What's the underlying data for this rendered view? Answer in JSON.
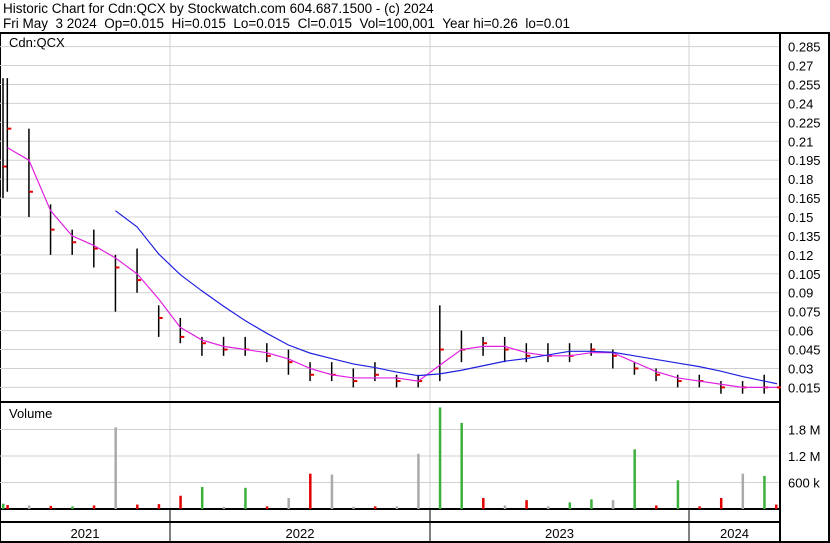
{
  "header": {
    "title": "Historic Chart for Cdn:QCX by Stockwatch.com 604.687.1500 - (c) 2024",
    "quote": "Fri May  3 2024  Op=0.015  Hi=0.015  Lo=0.015  Cl=0.015  Vol=100,001  Year hi=0.26  lo=0.01"
  },
  "chart_data": [
    {
      "type": "line",
      "title": "Cdn:QCX",
      "ylim": [
        0.005,
        0.295
      ],
      "yticks": [
        "0.285",
        "0.27",
        "0.255",
        "0.24",
        "0.225",
        "0.21",
        "0.195",
        "0.18",
        "0.165",
        "0.15",
        "0.135",
        "0.12",
        "0.105",
        "0.09",
        "0.075",
        "0.06",
        "0.045",
        "0.03",
        "0.015"
      ],
      "x_start": "2021-04",
      "x_end": "2024-05",
      "x_year_labels": [
        "2021",
        "2022",
        "2023",
        "2024"
      ],
      "x": [
        "2021-04",
        "2021-05",
        "2021-06",
        "2021-07",
        "2021-08",
        "2021-09",
        "2021-10",
        "2021-11",
        "2021-12",
        "2022-01",
        "2022-02",
        "2022-03",
        "2022-04",
        "2022-05",
        "2022-06",
        "2022-07",
        "2022-08",
        "2022-09",
        "2022-10",
        "2022-11",
        "2022-12",
        "2023-01",
        "2023-02",
        "2023-03",
        "2023-04",
        "2023-05",
        "2023-06",
        "2023-07",
        "2023-08",
        "2023-09",
        "2023-10",
        "2023-11",
        "2023-12",
        "2024-01",
        "2024-02",
        "2024-03",
        "2024-04",
        "2024-05"
      ],
      "close": [
        0.19,
        0.22,
        0.17,
        0.14,
        0.13,
        0.125,
        0.11,
        0.1,
        0.07,
        0.055,
        0.05,
        0.045,
        0.045,
        0.04,
        0.035,
        0.025,
        0.025,
        0.02,
        0.025,
        0.02,
        0.02,
        0.045,
        0.045,
        0.05,
        0.045,
        0.04,
        0.04,
        0.04,
        0.045,
        0.04,
        0.03,
        0.025,
        0.02,
        0.02,
        0.015,
        0.015,
        0.015,
        0.015
      ],
      "high": [
        0.26,
        0.26,
        0.22,
        0.16,
        0.14,
        0.14,
        0.12,
        0.125,
        0.08,
        0.07,
        0.055,
        0.055,
        0.055,
        0.05,
        0.045,
        0.035,
        0.035,
        0.03,
        0.035,
        0.025,
        0.025,
        0.08,
        0.06,
        0.055,
        0.055,
        0.05,
        0.05,
        0.05,
        0.05,
        0.045,
        0.035,
        0.03,
        0.025,
        0.025,
        0.02,
        0.02,
        0.025,
        0.015
      ],
      "low": [
        0.165,
        0.17,
        0.15,
        0.12,
        0.12,
        0.11,
        0.075,
        0.09,
        0.055,
        0.05,
        0.04,
        0.04,
        0.04,
        0.035,
        0.025,
        0.02,
        0.02,
        0.015,
        0.02,
        0.015,
        0.015,
        0.02,
        0.035,
        0.04,
        0.035,
        0.035,
        0.035,
        0.035,
        0.04,
        0.03,
        0.025,
        0.02,
        0.015,
        0.015,
        0.01,
        0.01,
        0.01,
        0.015
      ],
      "series": [
        {
          "name": "short moving average",
          "color": "#e020e0"
        },
        {
          "name": "long moving average",
          "color": "#2020e0"
        }
      ]
    },
    {
      "type": "bar",
      "title": "Volume",
      "ylim": [
        0,
        2400000
      ],
      "yticks": [
        "1.8 M",
        "1.2 M",
        "600 k"
      ],
      "bars": [
        {
          "date": "2021-04",
          "value": 120000,
          "color": "#3cb03c"
        },
        {
          "date": "2021-05",
          "value": 90000,
          "color": "#e00000"
        },
        {
          "date": "2021-06",
          "value": 80000,
          "color": "#aaaaaa"
        },
        {
          "date": "2021-07",
          "value": 70000,
          "color": "#e00000"
        },
        {
          "date": "2021-08",
          "value": 60000,
          "color": "#3cb03c"
        },
        {
          "date": "2021-09",
          "value": 80000,
          "color": "#e00000"
        },
        {
          "date": "2021-10",
          "value": 1850000,
          "color": "#aaaaaa"
        },
        {
          "date": "2021-11",
          "value": 100000,
          "color": "#e00000"
        },
        {
          "date": "2021-12",
          "value": 110000,
          "color": "#e00000"
        },
        {
          "date": "2022-01",
          "value": 300000,
          "color": "#e00000"
        },
        {
          "date": "2022-02",
          "value": 500000,
          "color": "#3cb03c"
        },
        {
          "date": "2022-03",
          "value": 50000,
          "color": "#aaaaaa"
        },
        {
          "date": "2022-04",
          "value": 480000,
          "color": "#3cb03c"
        },
        {
          "date": "2022-05",
          "value": 60000,
          "color": "#e00000"
        },
        {
          "date": "2022-06",
          "value": 250000,
          "color": "#aaaaaa"
        },
        {
          "date": "2022-07",
          "value": 800000,
          "color": "#e00000"
        },
        {
          "date": "2022-08",
          "value": 780000,
          "color": "#aaaaaa"
        },
        {
          "date": "2022-09",
          "value": 50000,
          "color": "#aaaaaa"
        },
        {
          "date": "2022-10",
          "value": 60000,
          "color": "#e00000"
        },
        {
          "date": "2022-11",
          "value": 60000,
          "color": "#aaaaaa"
        },
        {
          "date": "2022-12",
          "value": 1250000,
          "color": "#aaaaaa"
        },
        {
          "date": "2023-01",
          "value": 2300000,
          "color": "#3cb03c"
        },
        {
          "date": "2023-02",
          "value": 1950000,
          "color": "#3cb03c"
        },
        {
          "date": "2023-03",
          "value": 250000,
          "color": "#e00000"
        },
        {
          "date": "2023-04",
          "value": 80000,
          "color": "#aaaaaa"
        },
        {
          "date": "2023-05",
          "value": 200000,
          "color": "#e00000"
        },
        {
          "date": "2023-06",
          "value": 60000,
          "color": "#aaaaaa"
        },
        {
          "date": "2023-07",
          "value": 150000,
          "color": "#3cb03c"
        },
        {
          "date": "2023-08",
          "value": 220000,
          "color": "#3cb03c"
        },
        {
          "date": "2023-09",
          "value": 200000,
          "color": "#aaaaaa"
        },
        {
          "date": "2023-10",
          "value": 1350000,
          "color": "#3cb03c"
        },
        {
          "date": "2023-11",
          "value": 80000,
          "color": "#e00000"
        },
        {
          "date": "2023-12",
          "value": 650000,
          "color": "#3cb03c"
        },
        {
          "date": "2024-01",
          "value": 60000,
          "color": "#e00000"
        },
        {
          "date": "2024-02",
          "value": 250000,
          "color": "#e00000"
        },
        {
          "date": "2024-03",
          "value": 800000,
          "color": "#aaaaaa"
        },
        {
          "date": "2024-04",
          "value": 750000,
          "color": "#3cb03c"
        },
        {
          "date": "2024-05",
          "value": 100001,
          "color": "#e00000"
        }
      ]
    }
  ]
}
